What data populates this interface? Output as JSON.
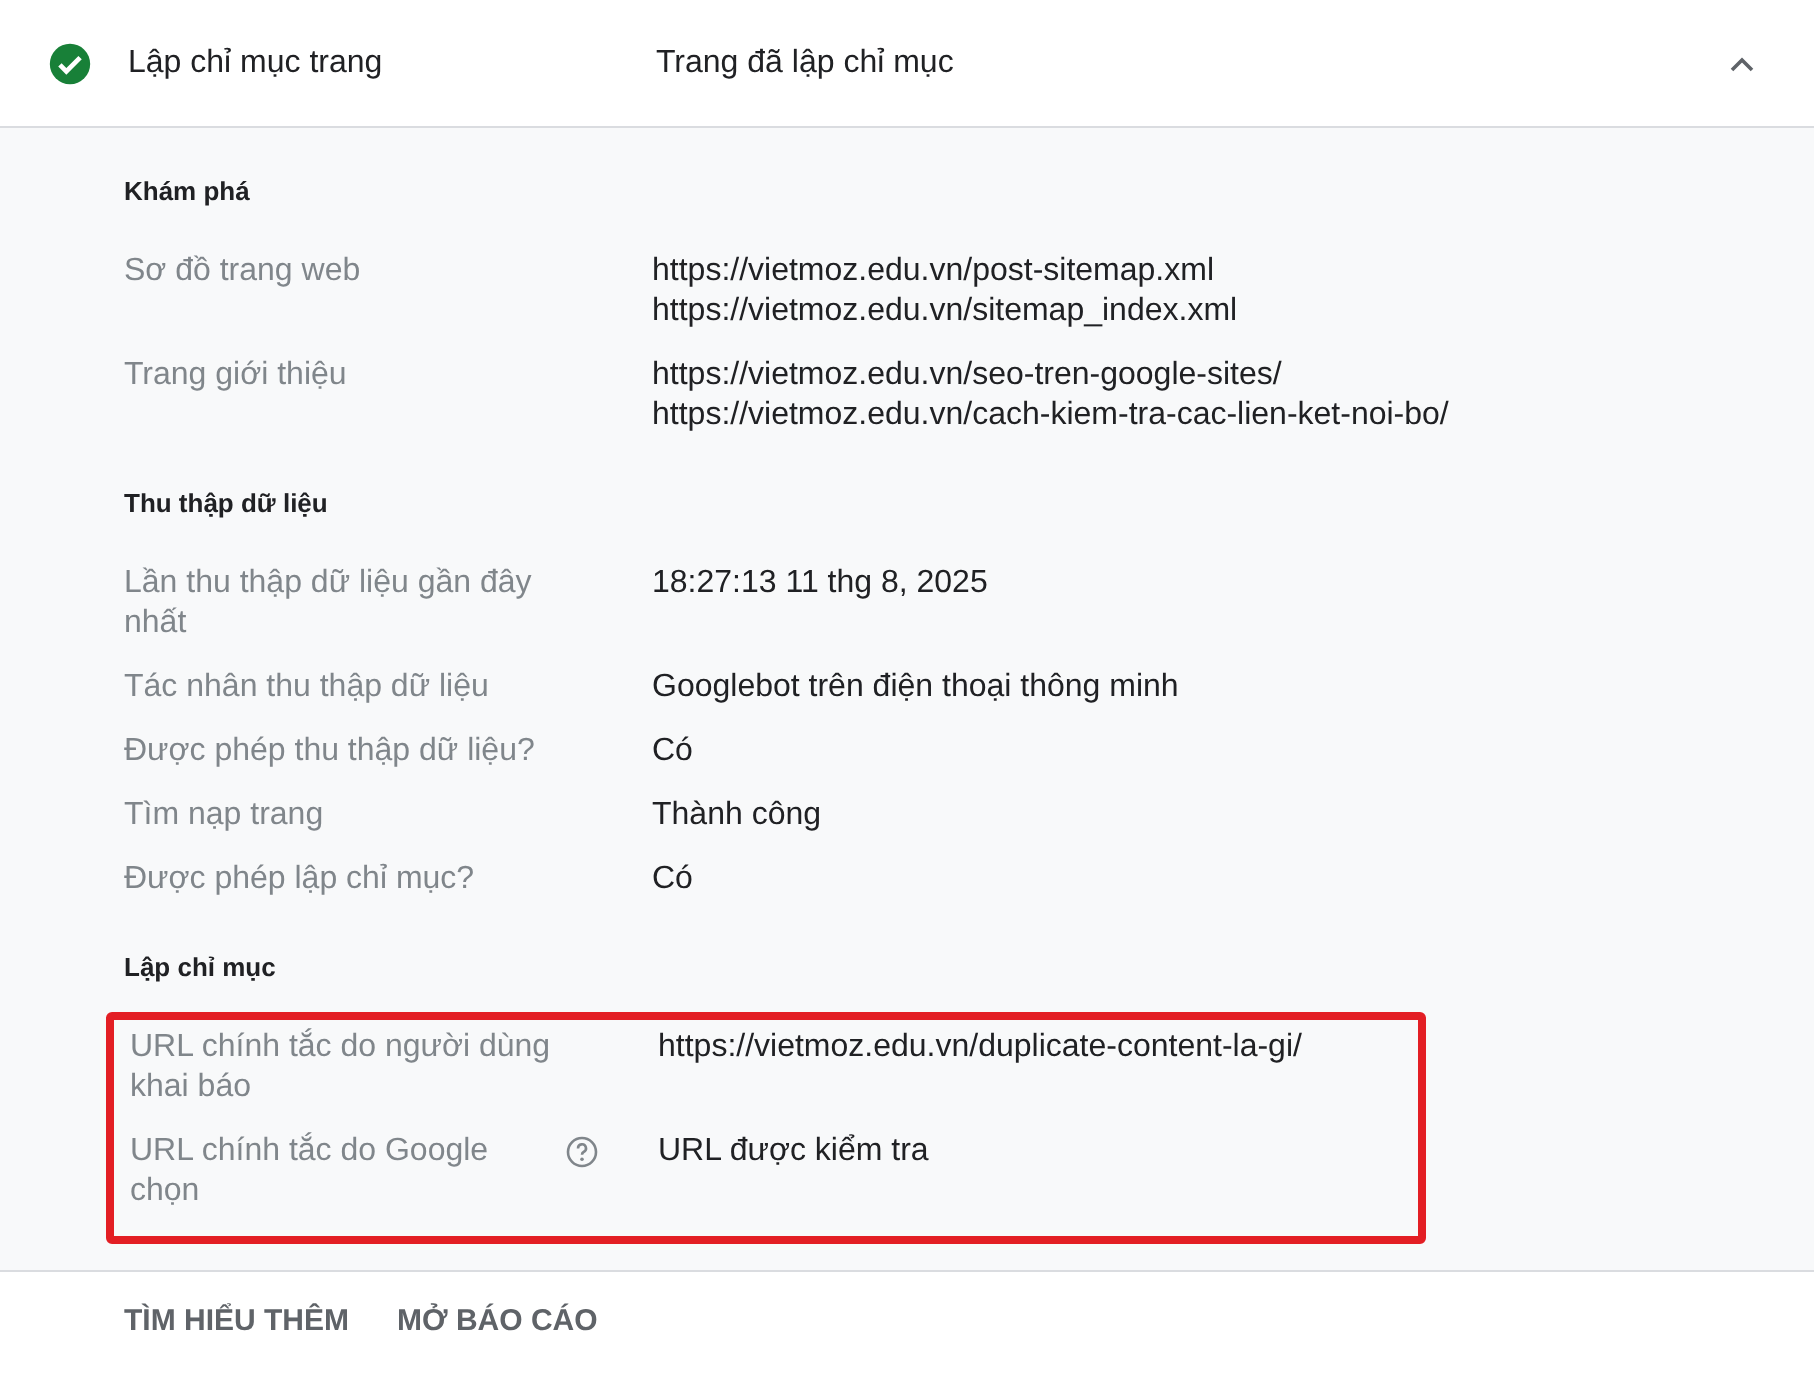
{
  "header": {
    "checked": true,
    "title": "Lập chỉ mục trang",
    "value": "Trang đã lập chỉ mục",
    "expanded": true
  },
  "sections": [
    {
      "title": "Khám phá",
      "highlighted": false,
      "rows": [
        {
          "label": "Sơ đồ trang web",
          "help": false,
          "values": [
            "https://vietmoz.edu.vn/post-sitemap.xml",
            "https://vietmoz.edu.vn/sitemap_index.xml"
          ]
        },
        {
          "label": "Trang giới thiệu",
          "help": false,
          "values": [
            "https://vietmoz.edu.vn/seo-tren-google-sites/",
            "https://vietmoz.edu.vn/cach-kiem-tra-cac-lien-ket-noi-bo/"
          ]
        }
      ]
    },
    {
      "title": "Thu thập dữ liệu",
      "highlighted": false,
      "rows": [
        {
          "label": "Lần thu thập dữ liệu gần đây nhất",
          "help": false,
          "values": [
            "18:27:13 11 thg 8, 2025"
          ]
        },
        {
          "label": "Tác nhân thu thập dữ liệu",
          "help": false,
          "values": [
            "Googlebot trên điện thoại thông minh"
          ]
        },
        {
          "label": "Được phép thu thập dữ liệu?",
          "help": false,
          "values": [
            "Có"
          ]
        },
        {
          "label": "Tìm nạp trang",
          "help": false,
          "values": [
            "Thành công"
          ]
        },
        {
          "label": "Được phép lập chỉ mục?",
          "help": false,
          "values": [
            "Có"
          ]
        }
      ]
    },
    {
      "title": "Lập chỉ mục",
      "highlighted": true,
      "rows": [
        {
          "label": "URL chính tắc do người dùng khai báo",
          "help": false,
          "values": [
            "https://vietmoz.edu.vn/duplicate-content-la-gi/"
          ]
        },
        {
          "label": "URL chính tắc do Google chọn",
          "help": true,
          "values": [
            "URL được kiểm tra"
          ]
        }
      ]
    }
  ],
  "footer_links": [
    "TÌM HIỂU THÊM",
    "MỞ BÁO CÁO"
  ]
}
